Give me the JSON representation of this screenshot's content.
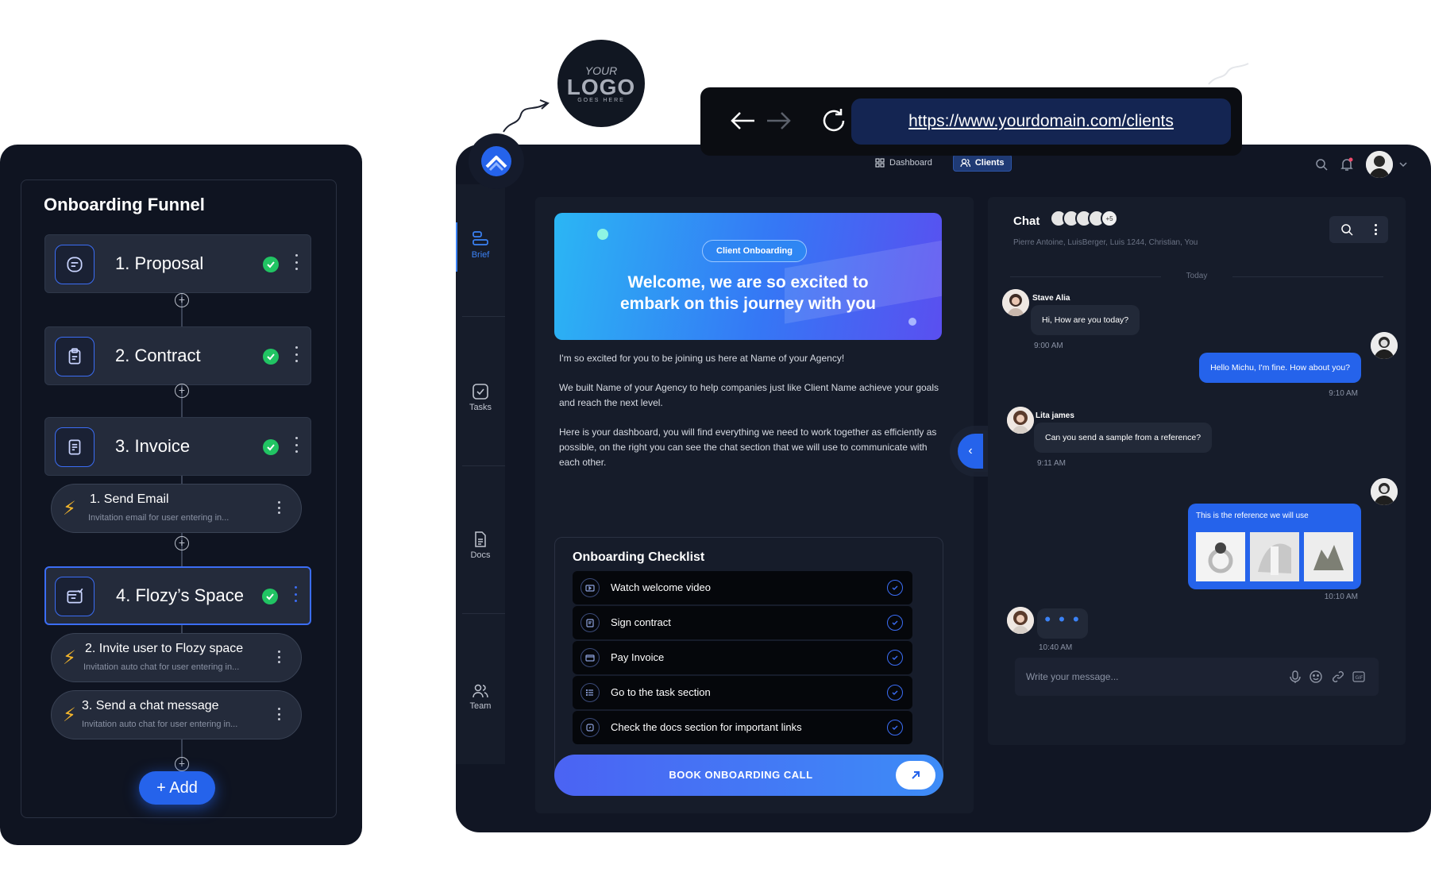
{
  "funnel": {
    "title": "Onboarding Funnel",
    "steps": [
      {
        "label": "1. Proposal"
      },
      {
        "label": "2. Contract"
      },
      {
        "label": "3. Invoice"
      },
      {
        "label": "4. Flozy’s Space"
      }
    ],
    "actions": [
      {
        "title": "1. Send Email",
        "subtitle": "Invitation email for user entering  in..."
      },
      {
        "title": "2. Invite user to Flozy space",
        "subtitle": "Invitation auto chat for user entering  in..."
      },
      {
        "title": "3. Send a chat message",
        "subtitle": "Invitation auto chat for user entering  in..."
      }
    ],
    "add_label": "Add"
  },
  "logo": {
    "line1": "YOUR",
    "line2": "LOGO",
    "line3": "GOES HERE"
  },
  "browser": {
    "url": "https://www.yourdomain.com/clients"
  },
  "nav": {
    "dashboard": "Dashboard",
    "clients": "Clients"
  },
  "sidebar": {
    "items": [
      {
        "label": "Brief"
      },
      {
        "label": "Tasks"
      },
      {
        "label": "Docs"
      },
      {
        "label": "Team"
      }
    ]
  },
  "brief": {
    "chip": "Client Onboarding",
    "hero_line1": "Welcome, we are so excited to",
    "hero_line2": "embark on this journey with you",
    "paragraphs": [
      "I'm so excited for you to be joining us here at Name of your Agency!",
      "We built Name of your Agency to help companies just like Client Name achieve your goals and reach the next level.",
      "Here is your dashboard, you will find everything we need to work together as efficiently as possible, on the right you can see the chat section that we will use to communicate with each other."
    ],
    "checklist_title": "Onboarding Checklist",
    "checklist": [
      {
        "label": "Watch welcome video"
      },
      {
        "label": "Sign contract"
      },
      {
        "label": "Pay Invoice"
      },
      {
        "label": "Go to the task section"
      },
      {
        "label": "Check the docs section for important links"
      }
    ],
    "book_label": "BOOK ONBOARDING CALL"
  },
  "chat": {
    "title": "Chat",
    "extra_count": "+5",
    "members": "Pierre Antoine, LuisBerger, Luis 1244, Christian, You",
    "today": "Today",
    "messages": [
      {
        "name": "Stave Alia",
        "text": "Hi, How are you today?",
        "time": "9:00 AM"
      },
      {
        "text": "Hello Michu, I'm fine. How about you?",
        "time": "9:10 AM"
      },
      {
        "name": "Lita james",
        "text": "Can you send a sample from a reference?",
        "time": "9:11 AM"
      },
      {
        "text": "This is the reference we will use",
        "time": "10:10 AM"
      },
      {
        "text": "• • •",
        "time": "10:40 AM"
      }
    ],
    "input_placeholder": "Write your message..."
  },
  "colors": {
    "accent": "#2563eb",
    "success": "#21c463",
    "panel": "#161c2a",
    "background": "#111624"
  }
}
